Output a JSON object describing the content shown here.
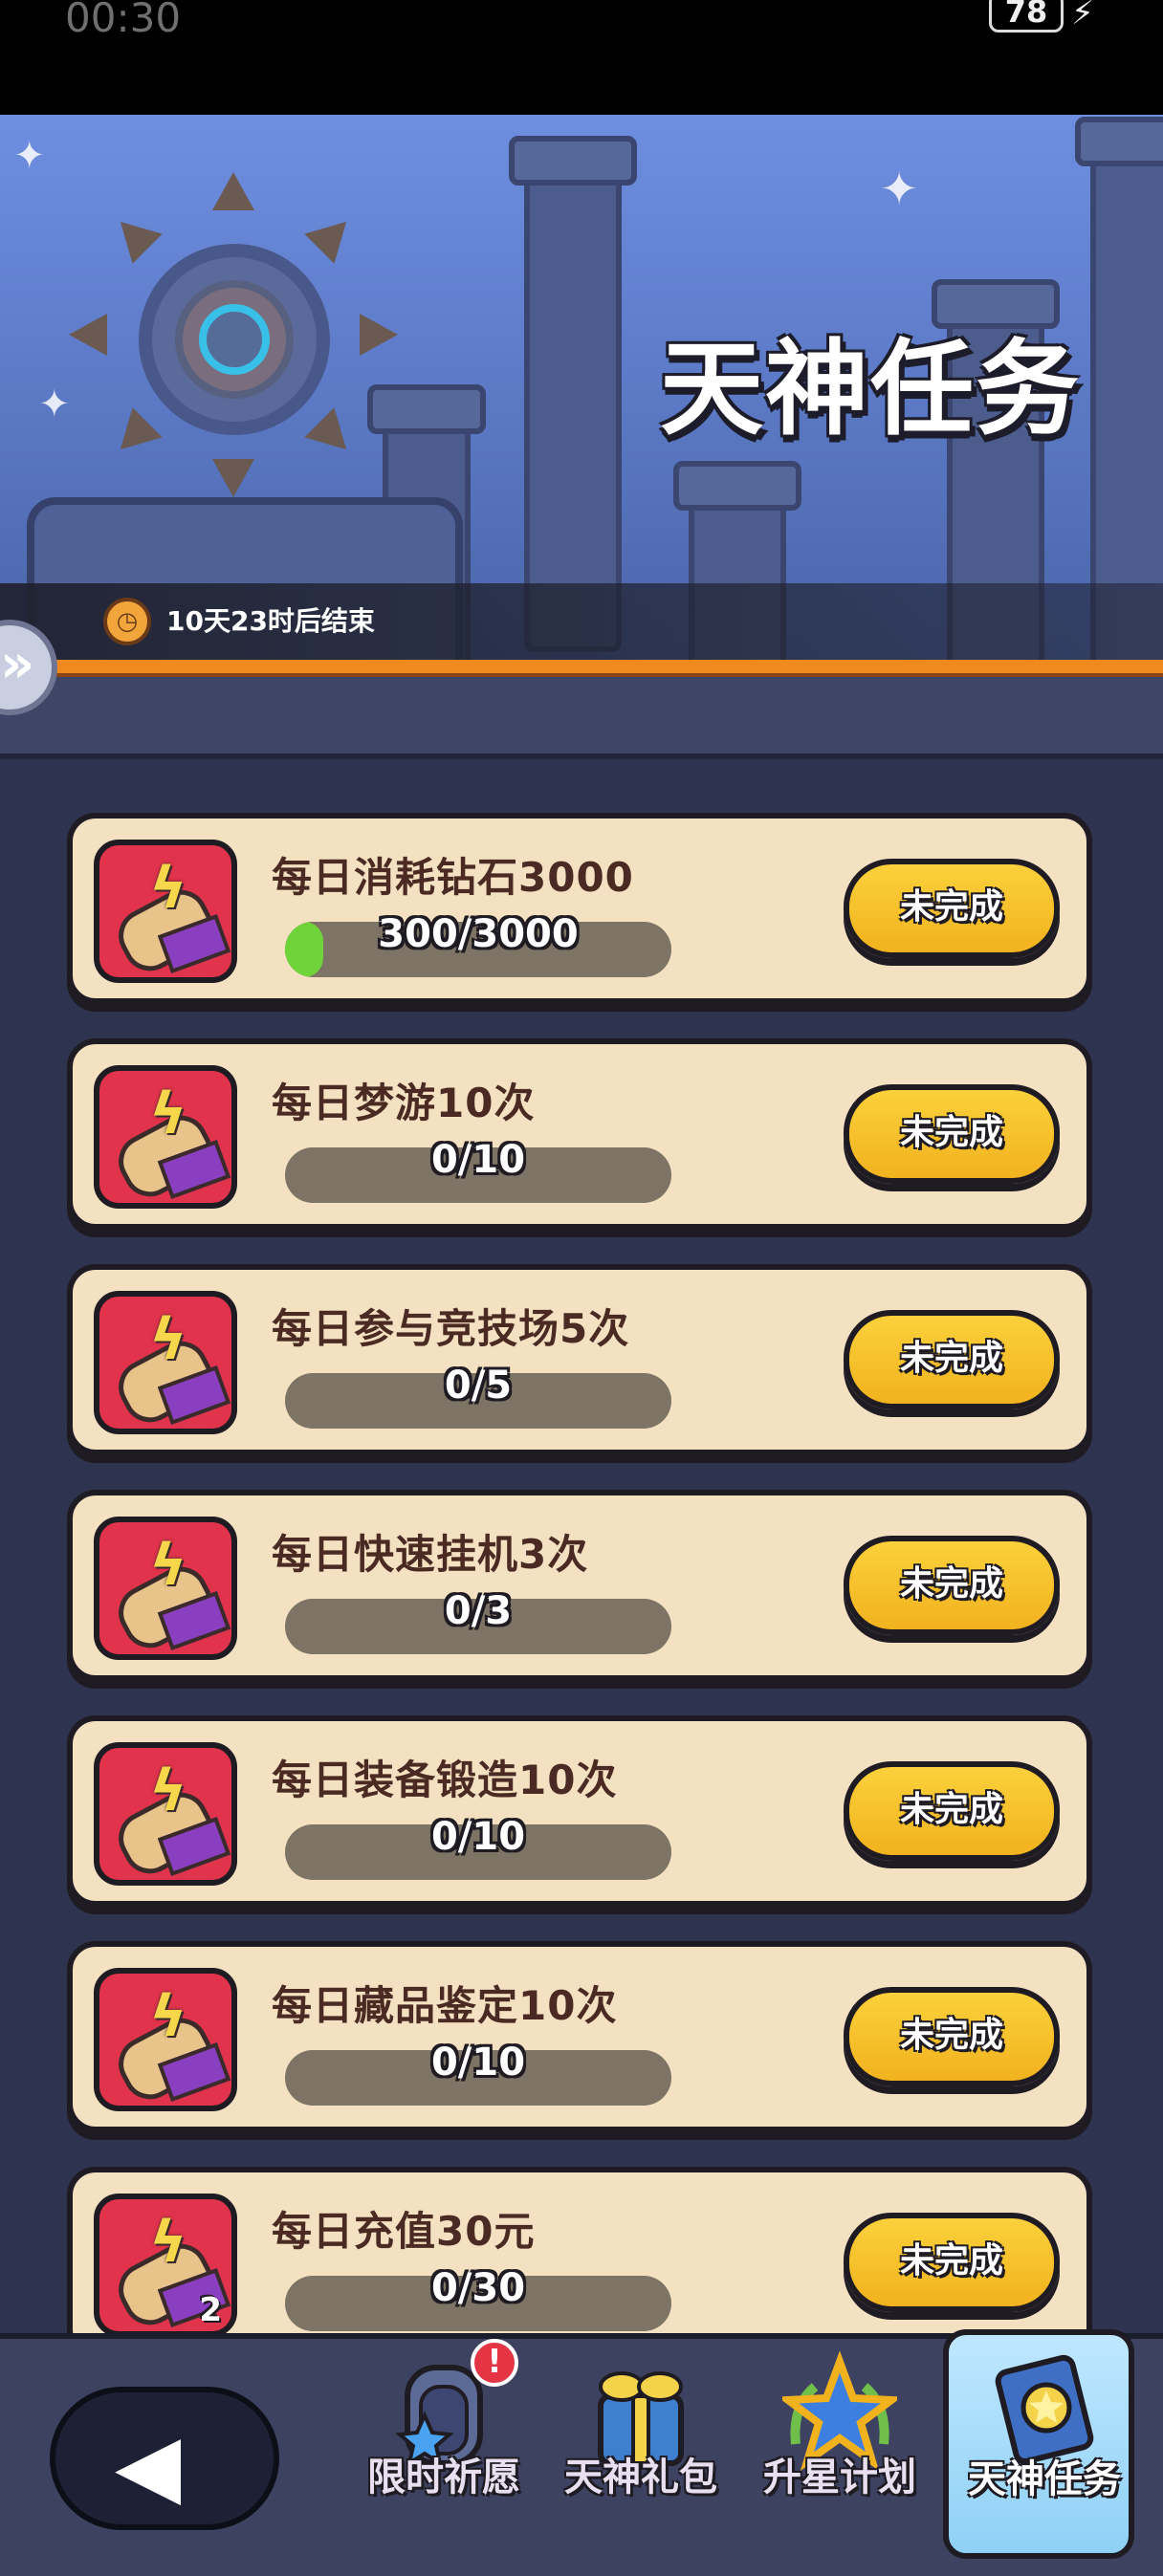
{
  "status_bar": {
    "time": "00:30",
    "battery": "78"
  },
  "banner": {
    "title": "天神任务",
    "timer_text": "10天23时后结束"
  },
  "tasks": [
    {
      "title": "每日消耗钻石3000",
      "progress_text": "300/3000",
      "progress": 0.1,
      "status": "未完成",
      "badge": ""
    },
    {
      "title": "每日梦游10次",
      "progress_text": "0/10",
      "progress": 0,
      "status": "未完成",
      "badge": ""
    },
    {
      "title": "每日参与竞技场5次",
      "progress_text": "0/5",
      "progress": 0,
      "status": "未完成",
      "badge": ""
    },
    {
      "title": "每日快速挂机3次",
      "progress_text": "0/3",
      "progress": 0,
      "status": "未完成",
      "badge": ""
    },
    {
      "title": "每日装备锻造10次",
      "progress_text": "0/10",
      "progress": 0,
      "status": "未完成",
      "badge": ""
    },
    {
      "title": "每日藏品鉴定10次",
      "progress_text": "0/10",
      "progress": 0,
      "status": "未完成",
      "badge": ""
    },
    {
      "title": "每日充值30元",
      "progress_text": "0/30",
      "progress": 0,
      "status": "未完成",
      "badge": "2"
    }
  ],
  "bottom_nav": {
    "tabs": [
      {
        "label": "限时祈愿",
        "icon": "wish-portal-icon",
        "alert": "!"
      },
      {
        "label": "天神礼包",
        "icon": "gift-box-icon",
        "alert": ""
      },
      {
        "label": "升星计划",
        "icon": "star-laurel-icon",
        "alert": ""
      },
      {
        "label": "天神任务",
        "icon": "quest-book-icon",
        "alert": "",
        "active": true
      }
    ]
  },
  "colors": {
    "progress_fill": "#6fd33a",
    "status_button": "#f1b21e",
    "task_card": "#f3e1c2",
    "accent_orange": "#f08a1f"
  }
}
